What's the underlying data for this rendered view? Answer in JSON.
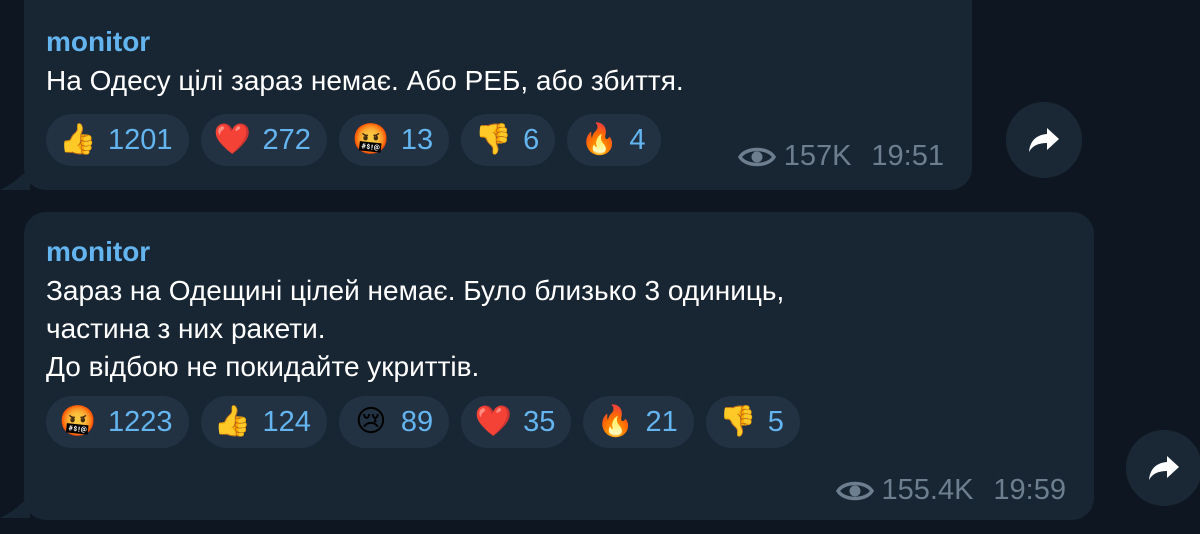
{
  "messages": [
    {
      "author": "monitor",
      "lines": [
        "На Одесу цілі зараз немає. Або РЕБ, або збиття."
      ],
      "reactions": [
        {
          "icon": "thumbs-up",
          "emoji": "👍",
          "count": "1201"
        },
        {
          "icon": "heart",
          "emoji": "❤️",
          "count": "272"
        },
        {
          "icon": "cursing-face",
          "emoji": "🤬",
          "count": "13"
        },
        {
          "icon": "thumbs-down",
          "emoji": "👎",
          "count": "6"
        },
        {
          "icon": "fire",
          "emoji": "🔥",
          "count": "4"
        }
      ],
      "views": "157K",
      "time": "19:51"
    },
    {
      "author": "monitor",
      "lines": [
        "Зараз на Одещині цілей немає. Було близько 3 одиниць,",
        "частина з них ракети.",
        "До відбою не покидайте укриттів."
      ],
      "reactions": [
        {
          "icon": "cursing-face",
          "emoji": "🤬",
          "count": "1223"
        },
        {
          "icon": "thumbs-up",
          "emoji": "👍",
          "count": "124"
        },
        {
          "icon": "crying-face",
          "emoji": "😢",
          "count": "89"
        },
        {
          "icon": "heart",
          "emoji": "❤️",
          "count": "35"
        },
        {
          "icon": "fire",
          "emoji": "🔥",
          "count": "21"
        },
        {
          "icon": "thumbs-down",
          "emoji": "👎",
          "count": "5"
        }
      ],
      "views": "155.4K",
      "time": "19:59"
    }
  ],
  "colors": {
    "background": "#0e1621",
    "bubble": "#182533",
    "accent": "#64b5ef",
    "meta": "#6d7f8f"
  },
  "icons": {
    "views": "eye-icon",
    "forward": "forward-arrow-icon"
  }
}
